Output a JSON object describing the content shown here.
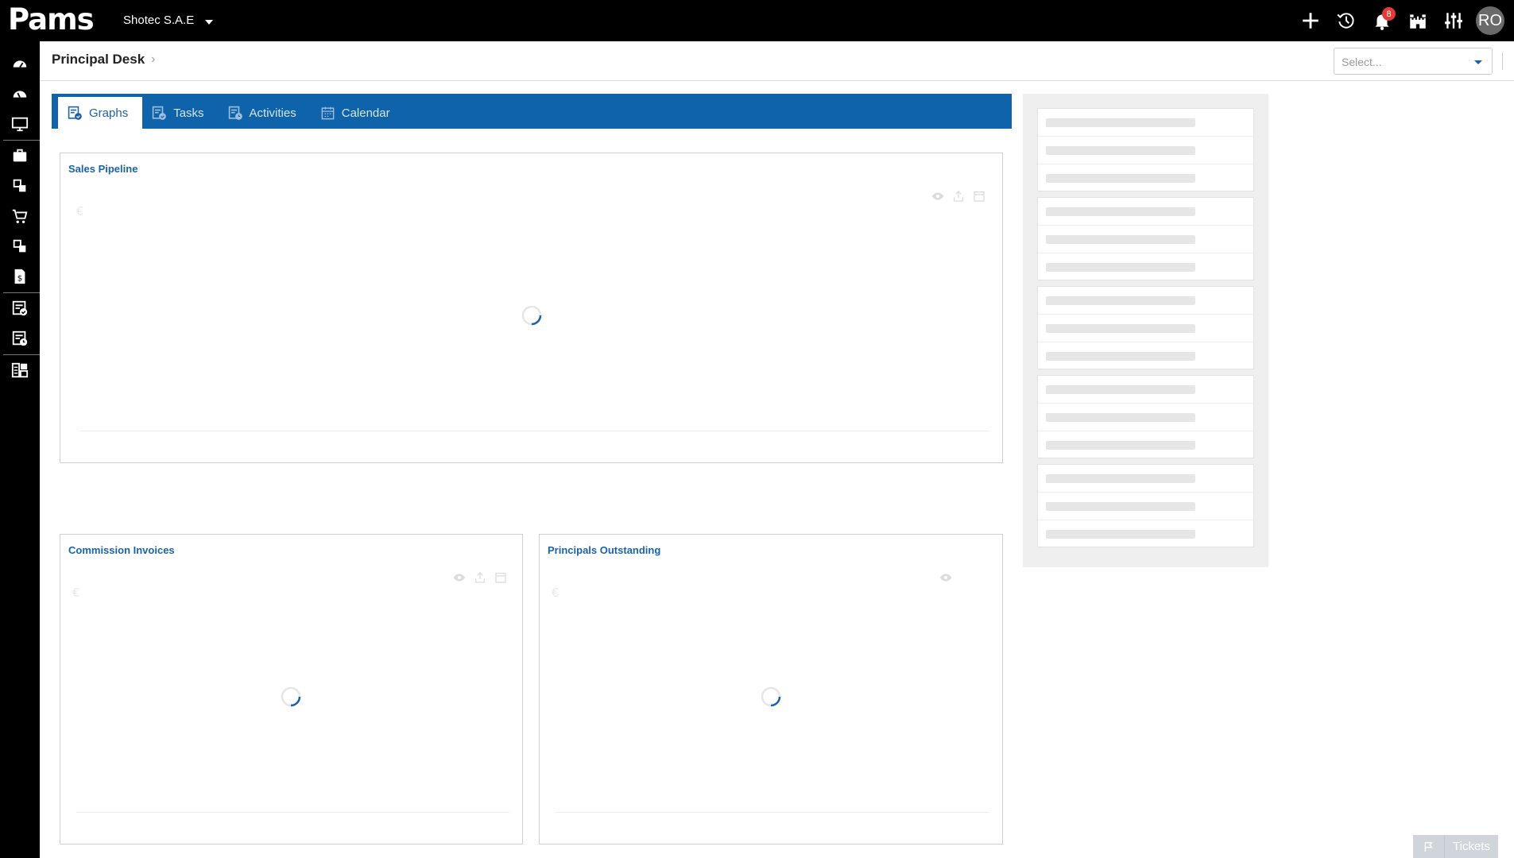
{
  "app": {
    "logo_text": "Pams",
    "company": "Shotec S.A.E"
  },
  "topbar": {
    "icons": [
      "plus-icon",
      "history-icon",
      "bell-icon",
      "castle-icon",
      "sliders-icon"
    ],
    "notification_count": "8",
    "avatar_initials": "RO"
  },
  "sidebar": {
    "icons": [
      "dashboard-icon",
      "dashboard-alt-icon",
      "monitor-icon",
      "briefcase-icon",
      "modules-icon",
      "cart-icon",
      "modules-alt-icon",
      "invoice-dollar-icon",
      "document-check-icon",
      "document-clock-icon",
      "grid-layout-icon"
    ]
  },
  "breadcrumb": {
    "title": "Principal Desk"
  },
  "select": {
    "placeholder": "Select..."
  },
  "tabs": [
    {
      "label": "Graphs",
      "icon": "graphs-icon",
      "active": true
    },
    {
      "label": "Tasks",
      "icon": "tasks-icon",
      "active": false
    },
    {
      "label": "Activities",
      "icon": "activities-icon",
      "active": false
    },
    {
      "label": "Calendar",
      "icon": "calendar-icon",
      "active": false
    }
  ],
  "cards": {
    "sales_pipeline": {
      "title": "Sales Pipeline",
      "currency": "€"
    },
    "commission_invoices": {
      "title": "Commission Invoices",
      "currency": "€"
    },
    "principals_outstanding": {
      "title": "Principals Outstanding",
      "currency": "€"
    }
  },
  "tickets": {
    "label": "Tickets"
  },
  "colors": {
    "brand_blue": "#0f63ab",
    "topbar": "#000000",
    "badge_red": "#e53935"
  }
}
